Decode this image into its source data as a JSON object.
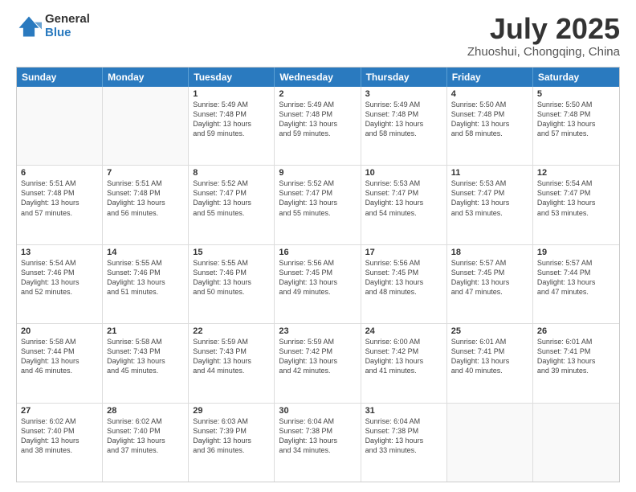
{
  "logo": {
    "general": "General",
    "blue": "Blue"
  },
  "header": {
    "title": "July 2025",
    "subtitle": "Zhuoshui, Chongqing, China"
  },
  "weekdays": [
    "Sunday",
    "Monday",
    "Tuesday",
    "Wednesday",
    "Thursday",
    "Friday",
    "Saturday"
  ],
  "weeks": [
    [
      {
        "day": "",
        "lines": [],
        "empty": true
      },
      {
        "day": "",
        "lines": [],
        "empty": true
      },
      {
        "day": "1",
        "lines": [
          "Sunrise: 5:49 AM",
          "Sunset: 7:48 PM",
          "Daylight: 13 hours",
          "and 59 minutes."
        ],
        "empty": false
      },
      {
        "day": "2",
        "lines": [
          "Sunrise: 5:49 AM",
          "Sunset: 7:48 PM",
          "Daylight: 13 hours",
          "and 59 minutes."
        ],
        "empty": false
      },
      {
        "day": "3",
        "lines": [
          "Sunrise: 5:49 AM",
          "Sunset: 7:48 PM",
          "Daylight: 13 hours",
          "and 58 minutes."
        ],
        "empty": false
      },
      {
        "day": "4",
        "lines": [
          "Sunrise: 5:50 AM",
          "Sunset: 7:48 PM",
          "Daylight: 13 hours",
          "and 58 minutes."
        ],
        "empty": false
      },
      {
        "day": "5",
        "lines": [
          "Sunrise: 5:50 AM",
          "Sunset: 7:48 PM",
          "Daylight: 13 hours",
          "and 57 minutes."
        ],
        "empty": false
      }
    ],
    [
      {
        "day": "6",
        "lines": [
          "Sunrise: 5:51 AM",
          "Sunset: 7:48 PM",
          "Daylight: 13 hours",
          "and 57 minutes."
        ],
        "empty": false
      },
      {
        "day": "7",
        "lines": [
          "Sunrise: 5:51 AM",
          "Sunset: 7:48 PM",
          "Daylight: 13 hours",
          "and 56 minutes."
        ],
        "empty": false
      },
      {
        "day": "8",
        "lines": [
          "Sunrise: 5:52 AM",
          "Sunset: 7:47 PM",
          "Daylight: 13 hours",
          "and 55 minutes."
        ],
        "empty": false
      },
      {
        "day": "9",
        "lines": [
          "Sunrise: 5:52 AM",
          "Sunset: 7:47 PM",
          "Daylight: 13 hours",
          "and 55 minutes."
        ],
        "empty": false
      },
      {
        "day": "10",
        "lines": [
          "Sunrise: 5:53 AM",
          "Sunset: 7:47 PM",
          "Daylight: 13 hours",
          "and 54 minutes."
        ],
        "empty": false
      },
      {
        "day": "11",
        "lines": [
          "Sunrise: 5:53 AM",
          "Sunset: 7:47 PM",
          "Daylight: 13 hours",
          "and 53 minutes."
        ],
        "empty": false
      },
      {
        "day": "12",
        "lines": [
          "Sunrise: 5:54 AM",
          "Sunset: 7:47 PM",
          "Daylight: 13 hours",
          "and 53 minutes."
        ],
        "empty": false
      }
    ],
    [
      {
        "day": "13",
        "lines": [
          "Sunrise: 5:54 AM",
          "Sunset: 7:46 PM",
          "Daylight: 13 hours",
          "and 52 minutes."
        ],
        "empty": false
      },
      {
        "day": "14",
        "lines": [
          "Sunrise: 5:55 AM",
          "Sunset: 7:46 PM",
          "Daylight: 13 hours",
          "and 51 minutes."
        ],
        "empty": false
      },
      {
        "day": "15",
        "lines": [
          "Sunrise: 5:55 AM",
          "Sunset: 7:46 PM",
          "Daylight: 13 hours",
          "and 50 minutes."
        ],
        "empty": false
      },
      {
        "day": "16",
        "lines": [
          "Sunrise: 5:56 AM",
          "Sunset: 7:45 PM",
          "Daylight: 13 hours",
          "and 49 minutes."
        ],
        "empty": false
      },
      {
        "day": "17",
        "lines": [
          "Sunrise: 5:56 AM",
          "Sunset: 7:45 PM",
          "Daylight: 13 hours",
          "and 48 minutes."
        ],
        "empty": false
      },
      {
        "day": "18",
        "lines": [
          "Sunrise: 5:57 AM",
          "Sunset: 7:45 PM",
          "Daylight: 13 hours",
          "and 47 minutes."
        ],
        "empty": false
      },
      {
        "day": "19",
        "lines": [
          "Sunrise: 5:57 AM",
          "Sunset: 7:44 PM",
          "Daylight: 13 hours",
          "and 47 minutes."
        ],
        "empty": false
      }
    ],
    [
      {
        "day": "20",
        "lines": [
          "Sunrise: 5:58 AM",
          "Sunset: 7:44 PM",
          "Daylight: 13 hours",
          "and 46 minutes."
        ],
        "empty": false
      },
      {
        "day": "21",
        "lines": [
          "Sunrise: 5:58 AM",
          "Sunset: 7:43 PM",
          "Daylight: 13 hours",
          "and 45 minutes."
        ],
        "empty": false
      },
      {
        "day": "22",
        "lines": [
          "Sunrise: 5:59 AM",
          "Sunset: 7:43 PM",
          "Daylight: 13 hours",
          "and 44 minutes."
        ],
        "empty": false
      },
      {
        "day": "23",
        "lines": [
          "Sunrise: 5:59 AM",
          "Sunset: 7:42 PM",
          "Daylight: 13 hours",
          "and 42 minutes."
        ],
        "empty": false
      },
      {
        "day": "24",
        "lines": [
          "Sunrise: 6:00 AM",
          "Sunset: 7:42 PM",
          "Daylight: 13 hours",
          "and 41 minutes."
        ],
        "empty": false
      },
      {
        "day": "25",
        "lines": [
          "Sunrise: 6:01 AM",
          "Sunset: 7:41 PM",
          "Daylight: 13 hours",
          "and 40 minutes."
        ],
        "empty": false
      },
      {
        "day": "26",
        "lines": [
          "Sunrise: 6:01 AM",
          "Sunset: 7:41 PM",
          "Daylight: 13 hours",
          "and 39 minutes."
        ],
        "empty": false
      }
    ],
    [
      {
        "day": "27",
        "lines": [
          "Sunrise: 6:02 AM",
          "Sunset: 7:40 PM",
          "Daylight: 13 hours",
          "and 38 minutes."
        ],
        "empty": false
      },
      {
        "day": "28",
        "lines": [
          "Sunrise: 6:02 AM",
          "Sunset: 7:40 PM",
          "Daylight: 13 hours",
          "and 37 minutes."
        ],
        "empty": false
      },
      {
        "day": "29",
        "lines": [
          "Sunrise: 6:03 AM",
          "Sunset: 7:39 PM",
          "Daylight: 13 hours",
          "and 36 minutes."
        ],
        "empty": false
      },
      {
        "day": "30",
        "lines": [
          "Sunrise: 6:04 AM",
          "Sunset: 7:38 PM",
          "Daylight: 13 hours",
          "and 34 minutes."
        ],
        "empty": false
      },
      {
        "day": "31",
        "lines": [
          "Sunrise: 6:04 AM",
          "Sunset: 7:38 PM",
          "Daylight: 13 hours",
          "and 33 minutes."
        ],
        "empty": false
      },
      {
        "day": "",
        "lines": [],
        "empty": true
      },
      {
        "day": "",
        "lines": [],
        "empty": true
      }
    ]
  ]
}
